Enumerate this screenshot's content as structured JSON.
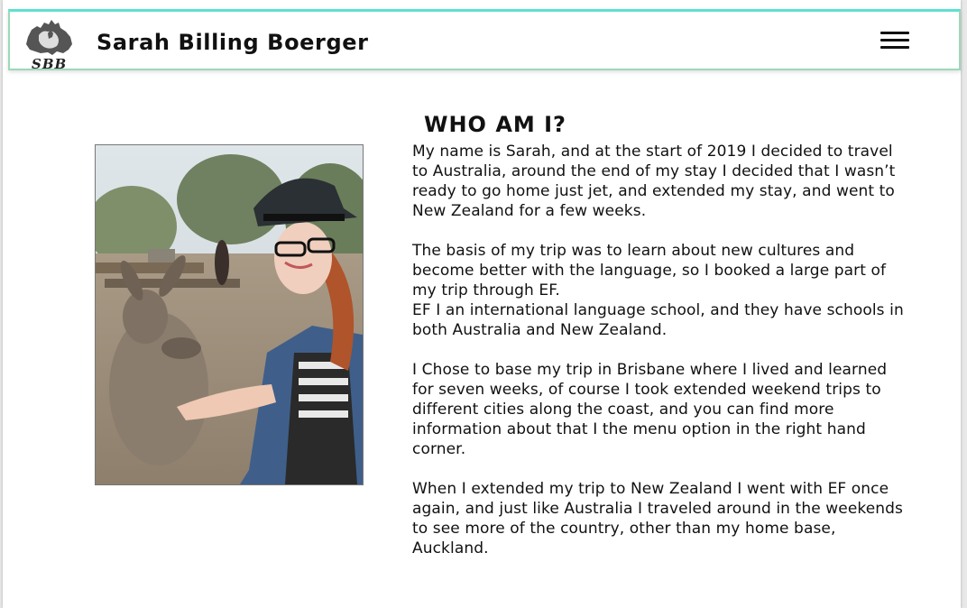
{
  "header": {
    "logo_text": "SBB",
    "site_title": "Sarah Billing Boerger",
    "menu_icon": "hamburger-menu-icon"
  },
  "main": {
    "photo_alt": "Sarah feeding a kangaroo",
    "heading": "WHO AM I?",
    "paragraphs": [
      "My name is Sarah, and at the start of 2019 I decided to travel to Australia, around the end of my stay I decided that I wasn’t ready to go home just jet, and extended my stay, and went to New Zealand for a few weeks.",
      "The basis of my trip was to learn about new cultures and become better with the language, so I booked a large part of my trip through EF.",
      "EF I an international language school, and they have schools in both Australia and New Zealand.",
      "I Chose to base my trip in Brisbane where I lived and learned for seven weeks, of course I took extended weekend trips to different cities along the coast, and you can find more information about that I the menu option in the right hand corner.",
      "When I extended my trip to New Zealand I went with EF once again, and just like Australia I traveled around in the weekends to see more of the country, other than my home base, Auckland."
    ]
  },
  "colors": {
    "header_border": "#9bd9b8",
    "header_top_accent": "#5ee0d0",
    "text": "#111111"
  }
}
